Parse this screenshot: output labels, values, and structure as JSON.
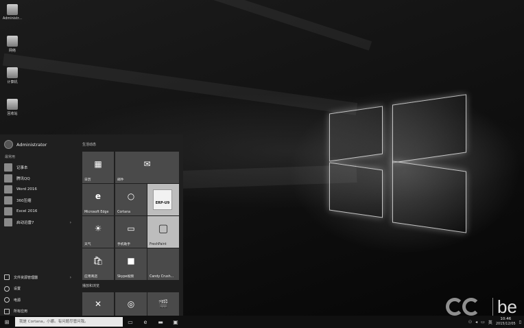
{
  "desktop": {
    "icons": [
      {
        "label": "Administr...",
        "icon": "user-folder-icon"
      },
      {
        "label": "网络",
        "icon": "network-icon"
      },
      {
        "label": "计算机",
        "icon": "computer-icon"
      },
      {
        "label": "回收站",
        "icon": "recycle-bin-icon"
      }
    ]
  },
  "start_menu": {
    "user_name": "Administrator",
    "recent_label": "最常用",
    "apps": [
      {
        "label": "记事本",
        "icon": "notepad-icon"
      },
      {
        "label": "腾讯QQ",
        "icon": "qq-icon"
      },
      {
        "label": "Word 2016",
        "icon": "word-icon"
      },
      {
        "label": "360压缩",
        "icon": "archive-icon"
      },
      {
        "label": "Excel 2016",
        "icon": "excel-icon"
      },
      {
        "label": "启动迅雷7",
        "icon": "thunder-icon",
        "has_submenu": true
      }
    ],
    "bottom": [
      {
        "label": "文件资源管理器",
        "icon": "file-explorer-icon",
        "has_submenu": true
      },
      {
        "label": "设置",
        "icon": "settings-icon"
      },
      {
        "label": "电源",
        "icon": "power-icon"
      },
      {
        "label": "所有应用",
        "icon": "all-apps-icon"
      }
    ],
    "tiles_group1": "生活动态",
    "tiles_group2": "播放和浏览",
    "tiles": [
      {
        "label": "日历",
        "glyph": "▦"
      },
      {
        "label": "邮件",
        "glyph": "✉"
      },
      {
        "label": "Microsoft Edge",
        "glyph": "e"
      },
      {
        "label": "Cortana",
        "glyph": "○"
      },
      {
        "label": "",
        "glyph": "ERP-U9"
      },
      {
        "label": "天气",
        "glyph": "☀"
      },
      {
        "label": "手机助手",
        "glyph": "▭"
      },
      {
        "label": "FreshPaint",
        "glyph": "▢"
      },
      {
        "label": "应用商店",
        "glyph": "🛍"
      },
      {
        "label": "Skype视频",
        "glyph": "■"
      },
      {
        "label": "Candy Crush...",
        "glyph": ""
      },
      {
        "label": "",
        "glyph": "✕"
      },
      {
        "label": "",
        "glyph": "◎"
      },
      {
        "label": "",
        "glyph": "🎬"
      }
    ]
  },
  "taskbar": {
    "search_placeholder": "我是 Cortana，小娜。有问题尽管问我。",
    "ime": "英",
    "time": "10:46",
    "date": "2015/12/05"
  },
  "watermark": {
    "text": "be"
  }
}
